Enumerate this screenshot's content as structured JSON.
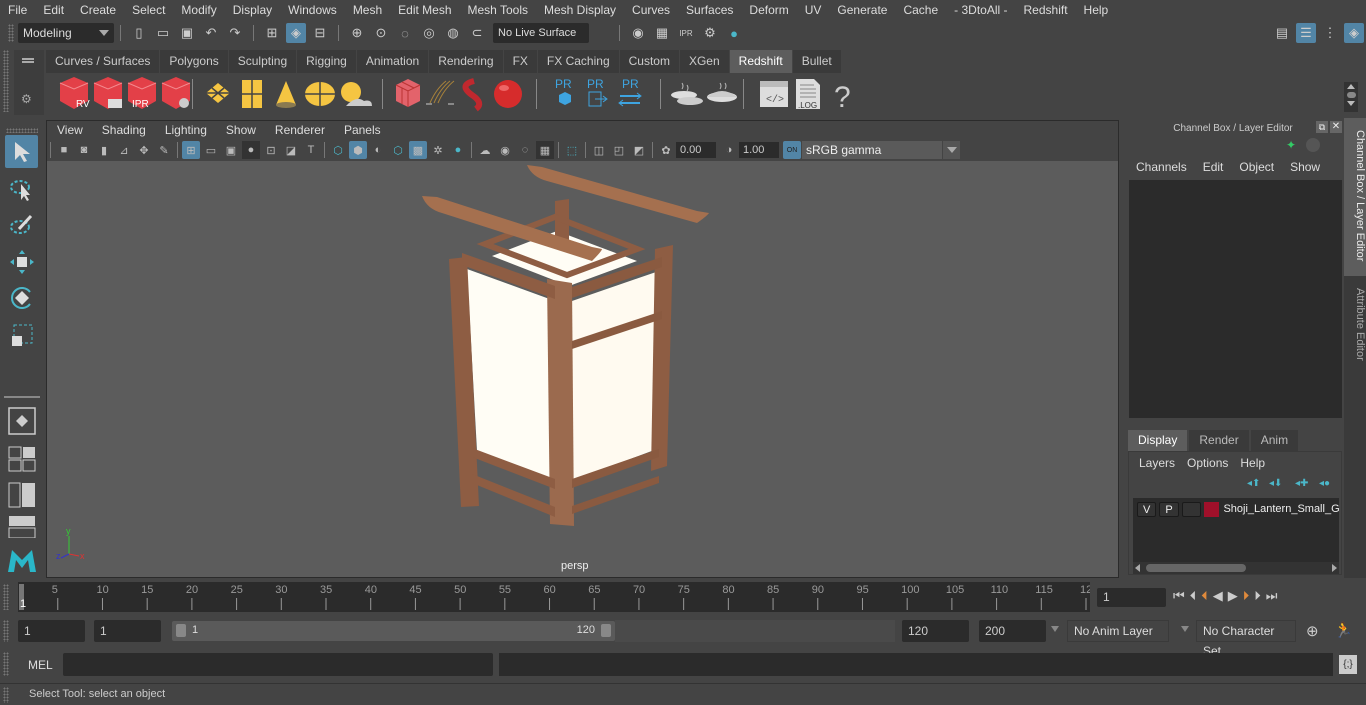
{
  "menubar": [
    "File",
    "Edit",
    "Create",
    "Select",
    "Modify",
    "Display",
    "Windows",
    "Mesh",
    "Edit Mesh",
    "Mesh Tools",
    "Mesh Display",
    "Curves",
    "Surfaces",
    "Deform",
    "UV",
    "Generate",
    "Cache",
    "- 3DtoAll -",
    "Redshift",
    "Help"
  ],
  "statusline": {
    "mode": "Modeling",
    "live_surface": "No Live Surface"
  },
  "shelf": {
    "tabs": [
      "Curves / Surfaces",
      "Polygons",
      "Sculpting",
      "Rigging",
      "Animation",
      "Rendering",
      "FX",
      "FX Caching",
      "Custom",
      "XGen",
      "Redshift",
      "Bullet"
    ],
    "active_tab": "Redshift",
    "icon_labels": {
      "rv": "RV",
      "ipr": "IPR",
      "pr": "PR",
      "log": ".LOG",
      "help": "?"
    }
  },
  "viewport": {
    "menu": [
      "View",
      "Shading",
      "Lighting",
      "Show",
      "Renderer",
      "Panels"
    ],
    "exposure": "0.00",
    "gamma": "1.00",
    "color_space": "sRGB gamma",
    "on_label": "ON",
    "camera_label": "persp",
    "axis": {
      "x": "x",
      "y": "y",
      "z": "z"
    }
  },
  "channel_box": {
    "title": "Channel Box / Layer Editor",
    "menu": [
      "Channels",
      "Edit",
      "Object",
      "Show"
    ]
  },
  "layer_editor": {
    "tabs": [
      "Display",
      "Render",
      "Anim"
    ],
    "active_tab": "Display",
    "menu": [
      "Layers",
      "Options",
      "Help"
    ],
    "layers": [
      {
        "v": "V",
        "p": "P",
        "color": "#a0102a",
        "name": "Shoji_Lantern_Small_G"
      }
    ]
  },
  "side_tabs": [
    "Channel Box / Layer Editor",
    "Attribute Editor"
  ],
  "timeline": {
    "ticks": [
      "5",
      "10",
      "15",
      "20",
      "25",
      "30",
      "35",
      "40",
      "45",
      "50",
      "55",
      "60",
      "65",
      "70",
      "75",
      "80",
      "85",
      "90",
      "95",
      "100",
      "105",
      "110",
      "115",
      "12"
    ],
    "current_frame_marker": "1",
    "current_frame": "1"
  },
  "range": {
    "start": "1",
    "playback_start": "1",
    "slider_start": "1",
    "slider_end": "120",
    "playback_end": "120",
    "end": "200",
    "anim_layer": "No Anim Layer",
    "character_set": "No Character Set"
  },
  "command": {
    "lang": "MEL"
  },
  "help_line": "Select Tool: select an object",
  "colors": {
    "accent": "#5285a6",
    "wood": "#9b6a4e",
    "paper": "#fffdf5",
    "redshift": "#e0323a"
  }
}
